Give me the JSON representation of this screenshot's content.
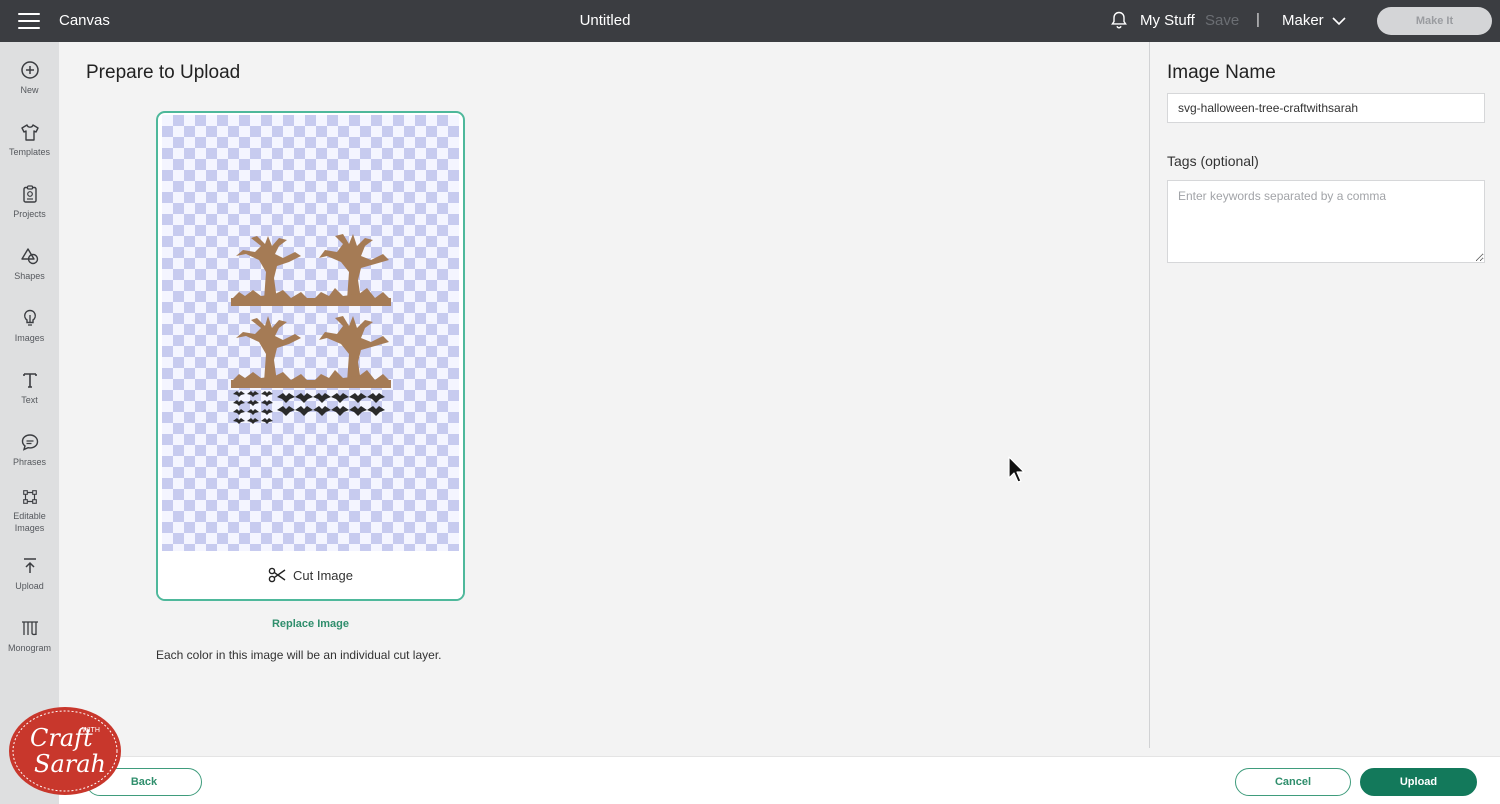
{
  "topbar": {
    "app_name": "Canvas",
    "document_title": "Untitled",
    "my_stuff": "My Stuff",
    "save": "Save",
    "separator": "|",
    "machine": "Maker",
    "make_it": "Make It"
  },
  "sidebar": {
    "items": [
      {
        "label": "New",
        "icon": "plus-circle-icon"
      },
      {
        "label": "Templates",
        "icon": "tshirt-icon"
      },
      {
        "label": "Projects",
        "icon": "clipboard-icon"
      },
      {
        "label": "Shapes",
        "icon": "shapes-icon"
      },
      {
        "label": "Images",
        "icon": "lightbulb-icon"
      },
      {
        "label": "Text",
        "icon": "text-icon"
      },
      {
        "label": "Phrases",
        "icon": "speech-bubble-icon"
      },
      {
        "label": "Editable Images",
        "icon": "editable-image-icon"
      },
      {
        "label": "Upload",
        "icon": "upload-icon"
      },
      {
        "label": "Monogram",
        "icon": "monogram-icon"
      }
    ]
  },
  "main": {
    "title": "Prepare to Upload",
    "card_footer_label": "Cut Image",
    "replace_link": "Replace Image",
    "note": "Each color in this image will be an individual cut layer."
  },
  "panel": {
    "name_heading": "Image Name",
    "name_value": "svg-halloween-tree-craftwithsarah",
    "tags_label": "Tags (optional)",
    "tags_placeholder": "Enter keywords separated by a comma"
  },
  "footer": {
    "back": "Back",
    "cancel": "Cancel",
    "upload": "Upload"
  },
  "watermark": {
    "text": "Craft with Sarah"
  },
  "colors": {
    "accent": "#13795b",
    "topbar": "#3b3d41",
    "tree_brown": "#a57b55",
    "bat_black": "#222222"
  }
}
